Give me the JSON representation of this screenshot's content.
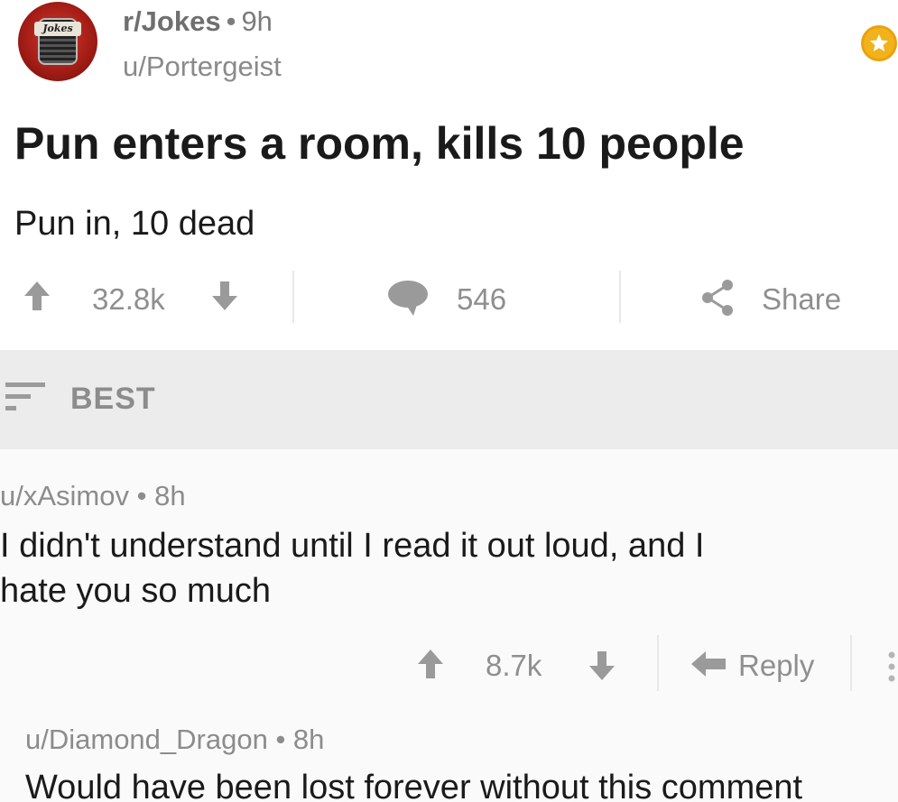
{
  "post": {
    "subreddit": "r/Jokes",
    "age": "9h",
    "author": "u/Portergeist",
    "subreddit_icon_label": "Jokes",
    "title": "Pun enters a room, kills 10 people",
    "body": "Pun in, 10 dead",
    "votes": "32.8k",
    "comments_count": "546",
    "share_label": "Share"
  },
  "sort": {
    "label": "BEST"
  },
  "comments": [
    {
      "author": "u/xAsimov",
      "age": "8h",
      "text_line1": "I didn't understand until I read it out loud, and I",
      "text_line2": "hate you so much",
      "votes": "8.7k",
      "reply_label": "Reply"
    },
    {
      "author": "u/Diamond_Dragon",
      "age": "8h",
      "text_line1": "Would have been lost forever without this comment"
    }
  ],
  "colors": {
    "accent_gold": "#f2b21b",
    "subreddit_red": "#a51e16",
    "icon_gray": "#9a9a9a",
    "sort_bg": "#ececec"
  },
  "icons": [
    "subreddit-icon",
    "award-icon",
    "upvote-icon",
    "downvote-icon",
    "comment-icon",
    "share-icon",
    "sort-icon",
    "reply-icon",
    "more-icon"
  ]
}
